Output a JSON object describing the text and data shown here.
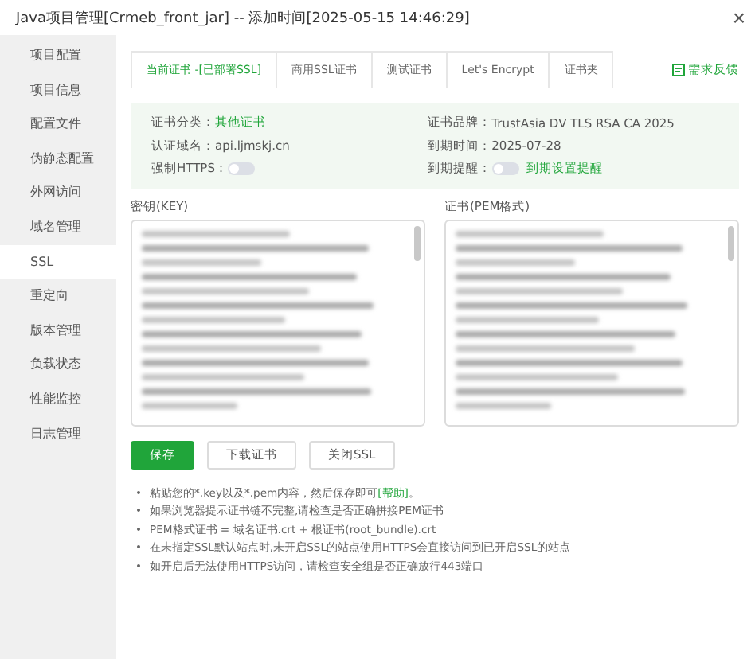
{
  "window": {
    "title": "Java项目管理[Crmeb_front_jar] -- 添加时间[2025-05-15 14:46:29]",
    "close": "×"
  },
  "sidebar": {
    "items": [
      {
        "label": "项目配置",
        "selected": false
      },
      {
        "label": "项目信息",
        "selected": false
      },
      {
        "label": "配置文件",
        "selected": false
      },
      {
        "label": "伪静态配置",
        "selected": false
      },
      {
        "label": "外网访问",
        "selected": false
      },
      {
        "label": "域名管理",
        "selected": false
      },
      {
        "label": "SSL",
        "selected": true
      },
      {
        "label": "重定向",
        "selected": false
      },
      {
        "label": "版本管理",
        "selected": false
      },
      {
        "label": "负载状态",
        "selected": false
      },
      {
        "label": "性能监控",
        "selected": false
      },
      {
        "label": "日志管理",
        "selected": false
      }
    ]
  },
  "tabs": [
    {
      "label": "当前证书 -[已部署SSL]",
      "selected": true
    },
    {
      "label": "商用SSL证书",
      "selected": false
    },
    {
      "label": "测试证书",
      "selected": false
    },
    {
      "label": "Let's Encrypt",
      "selected": false
    },
    {
      "label": "证书夹",
      "selected": false
    }
  ],
  "feedback_link": "需求反馈",
  "info": {
    "category_label": "证书分类：",
    "category": "其他证书",
    "domain_label": "认证域名：",
    "domain": "api.ljmskj.cn",
    "force_https_label": "强制HTTPS：",
    "force_https": false,
    "brand_label": "证书品牌：",
    "brand": "TrustAsia DV TLS RSA CA 2025",
    "expiry_label": "到期时间：",
    "expiry": "2025-07-28",
    "reminder_label": "到期提醒：",
    "reminder": false,
    "reminder_link": "到期设置提醒"
  },
  "key_field": {
    "label": "密钥(KEY)"
  },
  "cert_field": {
    "label": "证书(PEM格式)"
  },
  "buttons": [
    {
      "label": "保存",
      "kind": "primary"
    },
    {
      "label": "下载证书",
      "kind": "default"
    },
    {
      "label": "关闭SSL",
      "kind": "default"
    }
  ],
  "notes": [
    {
      "bullet": "•",
      "text": "粘贴您的*.key以及*.pem内容，然后保存即可**[帮助]**。"
    },
    {
      "bullet": "•",
      "text": "如果浏览器提示证书链不完整,请检查是否正确拼接PEM证书"
    },
    {
      "bullet": "•",
      "text": "PEM格式证书 = 域名证书.crt + 根证书(root_bundle).crt"
    },
    {
      "bullet": "•",
      "text": "在未指定SSL默认站点时,未开启SSL的站点使用HTTPS会直接访问到已开启SSL的站点"
    },
    {
      "bullet": "•",
      "text": "如开启后无法使用HTTPS访问，请检查安全组是否正确放行443端口"
    }
  ]
}
